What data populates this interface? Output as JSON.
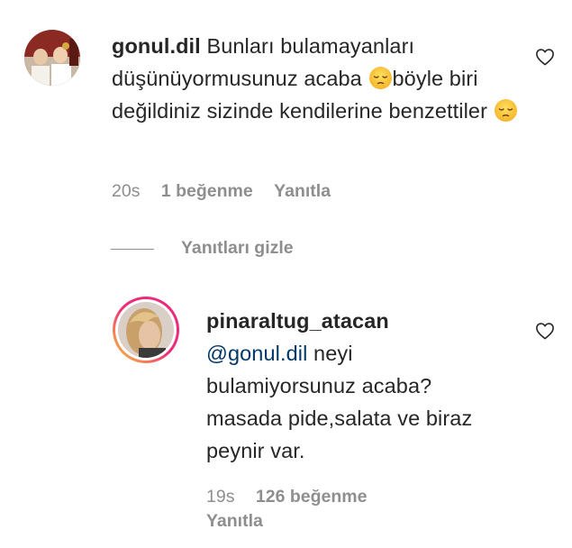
{
  "comment": {
    "username": "gonul.dil",
    "text_part1": "Bunları bulamayanları düşünüyormusunuz acaba",
    "text_part2": "böyle biri değildiniz sizinde kendilerine benzettiler",
    "emoji_1": "pensive-face",
    "emoji_2": "pensive-face",
    "time": "20s",
    "likes": "1 beğenme",
    "reply_label": "Yanıtla",
    "like_icon": "heart-icon"
  },
  "hide_replies_label": "Yanıtları gizle",
  "reply": {
    "username": "pinaraltug_atacan",
    "mention": "@gonul.dil",
    "text": "neyi bulamiyorsunuz acaba? masada pide,salata ve biraz peynir var.",
    "time": "19s",
    "likes": "126 beğenme",
    "reply_label": "Yanıtla",
    "like_icon": "heart-icon"
  },
  "colors": {
    "text": "#262626",
    "secondary": "#8e8e8e",
    "mention": "#00376b",
    "story_ring_start": "#f9ce34",
    "story_ring_mid": "#ee2a7b",
    "story_ring_end": "#6228d7"
  }
}
